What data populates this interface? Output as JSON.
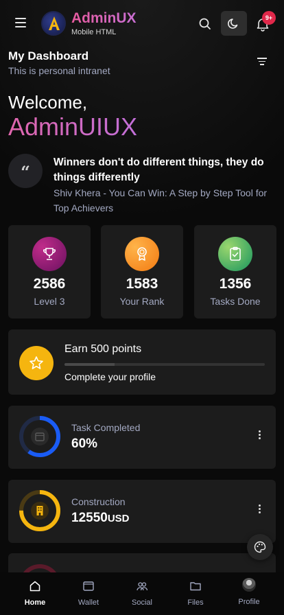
{
  "header": {
    "brand_title": "AdminUX",
    "brand_subtitle": "Mobile HTML",
    "notification_count": "9+"
  },
  "dashboard": {
    "title": "My Dashboard",
    "subtitle": "This is personal intranet",
    "welcome": "Welcome,",
    "welcome_name": "AdminUIUX"
  },
  "quote": {
    "text": "Winners don't do different things, they do things differently",
    "author": "Shiv Khera - You Can Win: A Step by Step Tool for Top Achievers",
    "icon": "quote-icon"
  },
  "stats": [
    {
      "value": "2586",
      "label": "Level 3",
      "icon": "trophy-icon",
      "color": "#a1206c"
    },
    {
      "value": "1583",
      "label": "Your Rank",
      "icon": "award-icon",
      "color": "#f59a1c"
    },
    {
      "value": "1356",
      "label": "Tasks Done",
      "icon": "clipboard-check-icon",
      "color": "#2fb36b"
    }
  ],
  "earn": {
    "title": "Earn 500 points",
    "subtitle": "Complete your profile",
    "progress": 0.25,
    "icon": "star-icon"
  },
  "progress_cards": [
    {
      "label": "Task Completed",
      "value": "60%",
      "unit": "",
      "percent": 60,
      "color": "#1a5cf5",
      "icon": "calendar-icon"
    },
    {
      "label": "Construction",
      "value": "12550",
      "unit": "USD",
      "percent": 75,
      "color": "#f5b50f",
      "icon": "building-icon"
    }
  ],
  "nav": [
    {
      "label": "Home",
      "icon": "home-icon",
      "active": true
    },
    {
      "label": "Wallet",
      "icon": "wallet-icon",
      "active": false
    },
    {
      "label": "Social",
      "icon": "users-icon",
      "active": false
    },
    {
      "label": "Files",
      "icon": "folder-icon",
      "active": false
    },
    {
      "label": "Profile",
      "icon": "avatar",
      "active": false
    }
  ],
  "colors": {
    "accent": "#e066ad",
    "badge": "#e0284a",
    "card": "#1c1c1c",
    "muted_text": "#a3a9c2"
  }
}
